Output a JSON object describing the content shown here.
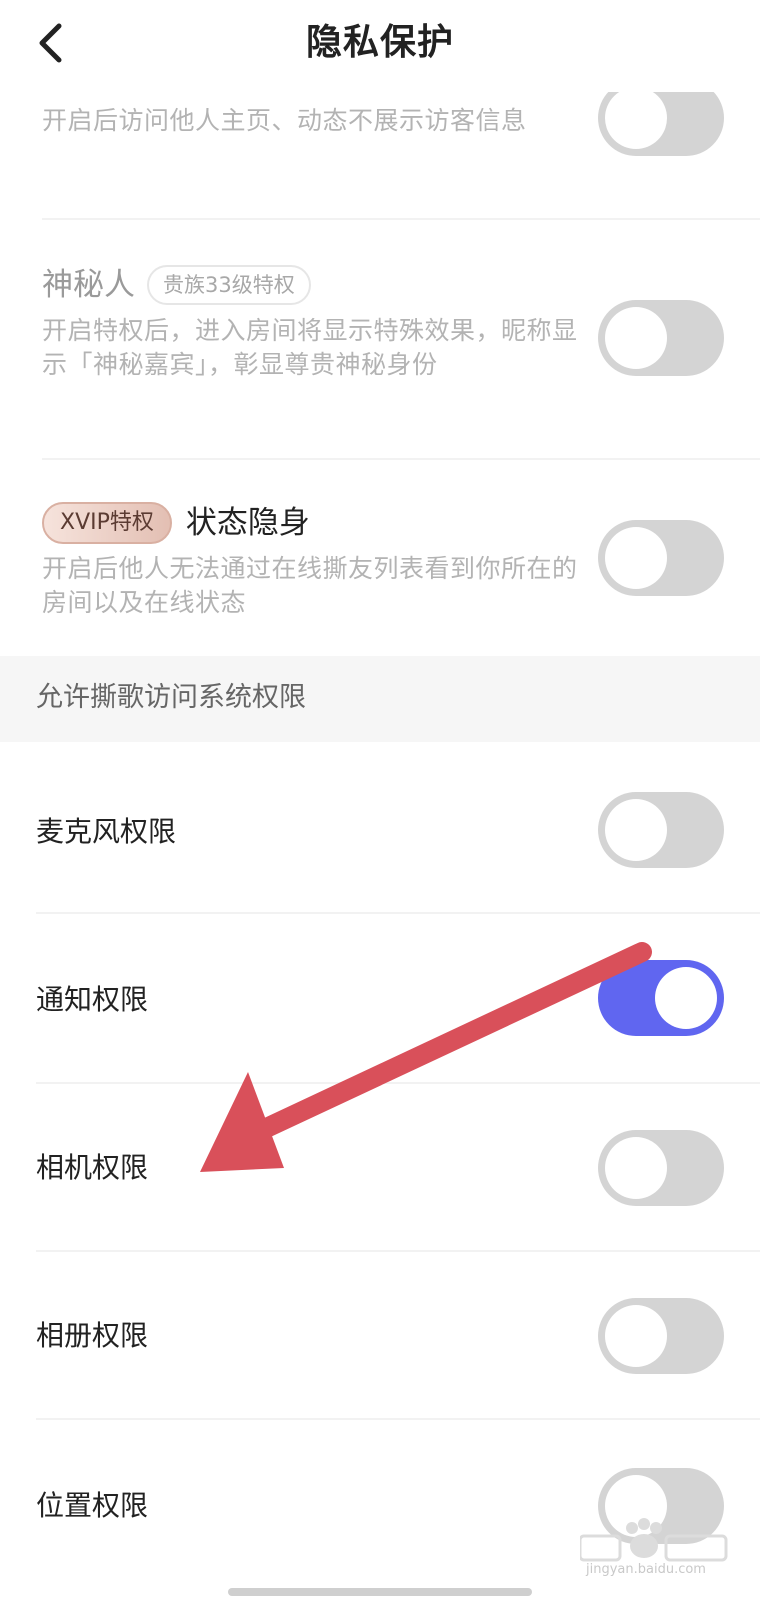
{
  "header": {
    "title": "隐私保护"
  },
  "privacy_items": [
    {
      "desc": "开启后访问他人主页、动态不展示访客信息"
    },
    {
      "title": "神秘人",
      "tag": "贵族33级特权",
      "desc": "开启特权后，进入房间将显示特殊效果，昵称显示「神秘嘉宾」，彰显尊贵神秘身份"
    },
    {
      "tag": "XVIP特权",
      "title": "状态隐身",
      "desc": "开启后他人无法通过在线撕友列表看到你所在的房间以及在线状态"
    }
  ],
  "section": {
    "title": "允许撕歌访问系统权限"
  },
  "permissions": [
    {
      "label": "麦克风权限",
      "enabled": false
    },
    {
      "label": "通知权限",
      "enabled": true
    },
    {
      "label": "相机权限",
      "enabled": false
    },
    {
      "label": "相册权限",
      "enabled": false
    },
    {
      "label": "位置权限",
      "enabled": false
    }
  ],
  "watermark": {
    "text": "jingyan.baidu.com"
  },
  "colors": {
    "toggle_on": "#6066f0",
    "toggle_off": "#d4d4d4",
    "arrow": "#d9505a"
  }
}
